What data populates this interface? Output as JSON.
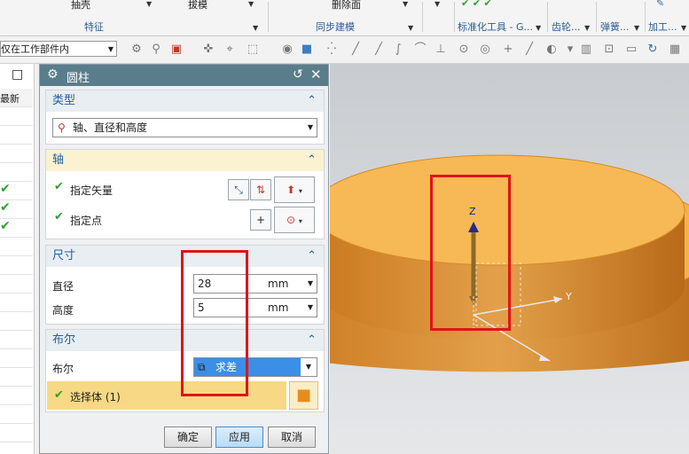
{
  "ribbon": {
    "top_items": [
      "抽壳",
      "拔模",
      "删除面"
    ],
    "groups": [
      "特征",
      "同步建模",
      "标准化工具 - G...",
      "齿轮...",
      "弹簧...",
      "加工..."
    ]
  },
  "toolbar": {
    "filter_value": "仅在工作部件内"
  },
  "leftnav": {
    "header": "最新"
  },
  "dialog": {
    "title": "圆柱",
    "sections": {
      "type": {
        "header": "类型",
        "value": "轴、直径和高度"
      },
      "axis": {
        "header": "轴",
        "vector_label": "指定矢量",
        "point_label": "指定点"
      },
      "dimensions": {
        "header": "尺寸",
        "diameter_label": "直径",
        "diameter_value": "28",
        "diameter_unit": "mm",
        "height_label": "高度",
        "height_value": "5",
        "height_unit": "mm"
      },
      "boolean": {
        "header": "布尔",
        "label": "布尔",
        "value": "求差",
        "select_body": "选择体 (1)"
      }
    },
    "buttons": {
      "ok": "确定",
      "apply": "应用",
      "cancel": "取消"
    }
  },
  "viewport": {
    "axis_z": "Z",
    "axis_y": "Y"
  },
  "colors": {
    "dialog_title_bg": "#5a7d8c",
    "section_header": "#1f5fa0",
    "check": "#2ea02e",
    "highlight_red": "#e0141a",
    "cylinder_orange": "#f5b24a",
    "boolean_selected": "#3c8fe6"
  }
}
